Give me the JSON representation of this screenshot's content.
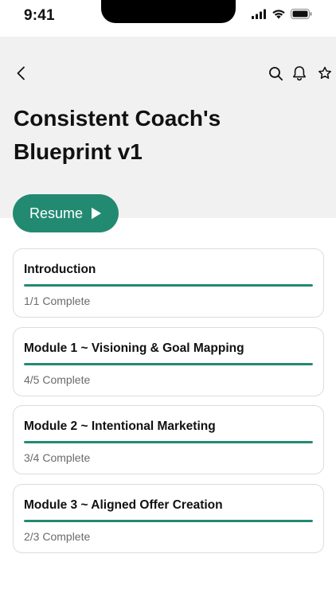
{
  "status_bar": {
    "time": "9:41",
    "icons": [
      "signal-icon",
      "wifi-icon",
      "battery-icon"
    ]
  },
  "header": {
    "back_icon": "chevron-left-icon",
    "action_icons": [
      "search-icon",
      "bell-icon",
      "star-icon"
    ],
    "title": "Consistent Coach's Blueprint v1"
  },
  "resume": {
    "label": "Resume",
    "icon": "play-icon"
  },
  "modules": [
    {
      "title": "Introduction",
      "status": "1/1 Complete",
      "progress": 1.0
    },
    {
      "title": "Module 1 ~ Visioning & Goal Mapping",
      "status": "4/5 Complete",
      "progress": 1.0
    },
    {
      "title": "Module 2 ~ Intentional Marketing",
      "status": "3/4 Complete",
      "progress": 1.0
    },
    {
      "title": "Module 3 ~ Aligned Offer Creation",
      "status": "2/3 Complete",
      "progress": 1.0
    }
  ],
  "colors": {
    "accent": "#238a72",
    "header_bg": "#f1f1f1",
    "card_border": "#dcdcdc",
    "muted_text": "#6b6b6b"
  }
}
